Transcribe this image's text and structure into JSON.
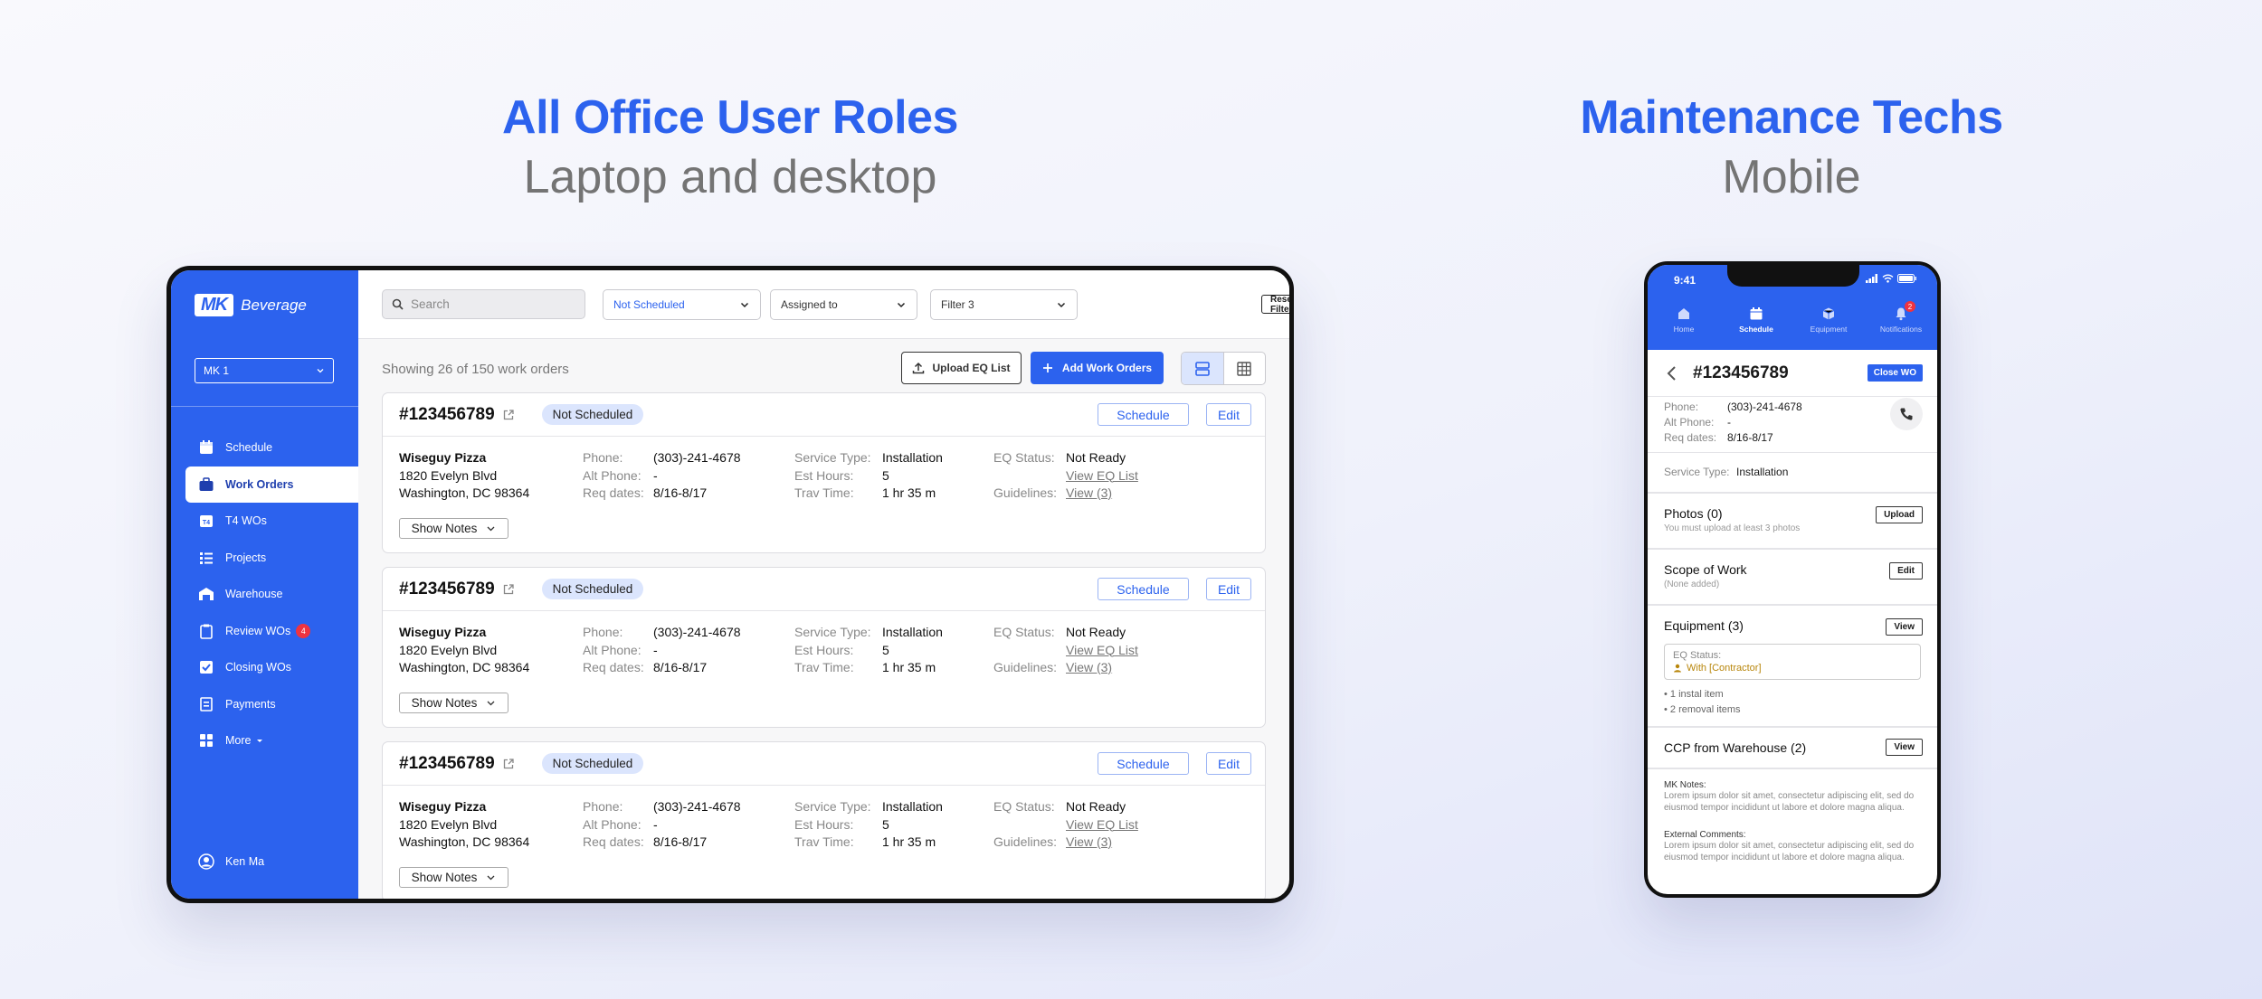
{
  "hero_left": {
    "title": "All Office User Roles",
    "subtitle": "Laptop and desktop"
  },
  "hero_right": {
    "title": "Maintenance Techs",
    "subtitle": "Mobile"
  },
  "sidebar": {
    "logo_mk": "MK",
    "logo_text": "Beverage",
    "location": "MK 1",
    "items": [
      {
        "label": "Schedule",
        "icon": "calendar-icon"
      },
      {
        "label": "Work Orders",
        "icon": "briefcase-icon",
        "active": true
      },
      {
        "label": "T4 WOs",
        "icon": "t4-icon"
      },
      {
        "label": "Projects",
        "icon": "list-icon"
      },
      {
        "label": "Warehouse",
        "icon": "warehouse-icon"
      },
      {
        "label": "Review WOs",
        "icon": "clipboard-icon",
        "badge": "4"
      },
      {
        "label": "Closing WOs",
        "icon": "check-square-icon"
      },
      {
        "label": "Payments",
        "icon": "receipt-icon"
      },
      {
        "label": "More",
        "icon": "grid-icon"
      }
    ],
    "user": "Ken Ma"
  },
  "topbar": {
    "search_placeholder": "Search",
    "filter_status": "Not Scheduled",
    "filter_assigned": "Assigned to",
    "filter_3": "Filter 3",
    "reset_label": "Reset Filters",
    "notifications": "2"
  },
  "content": {
    "showing": "Showing 26 of 150 work orders",
    "upload_label": "Upload EQ List",
    "add_label": "Add Work Orders"
  },
  "labels": {
    "phone": "Phone:",
    "alt_phone": "Alt Phone:",
    "req_dates": "Req dates:",
    "service_type": "Service Type:",
    "est_hours": "Est Hours:",
    "trav_time": "Trav Time:",
    "eq_status": "EQ Status:",
    "guidelines": "Guidelines:",
    "schedule": "Schedule",
    "edit": "Edit",
    "show_notes": "Show Notes"
  },
  "work_orders": [
    {
      "id": "#123456789",
      "status": "Not Scheduled",
      "name": "Wiseguy Pizza",
      "address1": "1820 Evelyn Blvd",
      "address2": "Washington, DC 98364",
      "phone": "(303)-241-4678",
      "alt_phone": "-",
      "req_dates": "8/16-8/17",
      "service_type": "Installation",
      "est_hours": "5",
      "trav_time": "1 hr 35 m",
      "eq_status": "Not Ready",
      "eq_link": "View EQ List",
      "guidelines": "View (3)"
    },
    {
      "id": "#123456789",
      "status": "Not Scheduled",
      "name": "Wiseguy Pizza",
      "address1": "1820 Evelyn Blvd",
      "address2": "Washington, DC 98364",
      "phone": "(303)-241-4678",
      "alt_phone": "-",
      "req_dates": "8/16-8/17",
      "service_type": "Installation",
      "est_hours": "5",
      "trav_time": "1 hr 35 m",
      "eq_status": "Not Ready",
      "eq_link": "View EQ List",
      "guidelines": "View (3)"
    },
    {
      "id": "#123456789",
      "status": "Not Scheduled",
      "name": "Wiseguy Pizza",
      "address1": "1820 Evelyn Blvd",
      "address2": "Washington, DC 98364",
      "phone": "(303)-241-4678",
      "alt_phone": "-",
      "req_dates": "8/16-8/17",
      "service_type": "Installation",
      "est_hours": "5",
      "trav_time": "1 hr 35 m",
      "eq_status": "Not Ready",
      "eq_link": "View EQ List",
      "guidelines": "View (3)"
    }
  ],
  "phone": {
    "time": "9:41",
    "tabs": [
      {
        "label": "Home",
        "icon": "home-icon"
      },
      {
        "label": "Schedule",
        "icon": "calendar-icon",
        "active": true
      },
      {
        "label": "Equipment",
        "icon": "box-icon"
      },
      {
        "label": "Notifications",
        "icon": "bell-icon",
        "badge": "2"
      }
    ],
    "wo_id": "#123456789",
    "close_label": "Close WO",
    "phone_label": "Phone:",
    "phone_value": "(303)-241-4678",
    "alt_label": "Alt Phone:",
    "alt_value": "-",
    "req_label": "Req dates:",
    "req_value": "8/16-8/17",
    "service_label": "Service Type:",
    "service_value": "Installation",
    "photos_title": "Photos (0)",
    "photos_sub": "You must upload at least 3 photos",
    "upload_label": "Upload",
    "scope_title": "Scope of Work",
    "scope_sub": "(None added)",
    "edit_label": "Edit",
    "equipment_title": "Equipment (3)",
    "view_label": "View",
    "eq_status_label": "EQ Status:",
    "eq_status_value": "With [Contractor]",
    "bullets": [
      "1 instal item",
      "2 removal items"
    ],
    "ccp_title": "CCP from Warehouse (2)",
    "mk_notes_label": "MK Notes:",
    "mk_notes": "Lorem ipsum dolor sit amet, consectetur adipiscing elit, sed do eiusmod tempor incididunt ut labore et dolore magna aliqua.",
    "ext_label": "External Comments:",
    "ext_notes": "Lorem ipsum dolor sit amet, consectetur adipiscing elit, sed do eiusmod tempor incididunt ut labore et dolore magna aliqua."
  },
  "colors": {
    "accent": "#2c62ee",
    "badge": "#ef3340",
    "pill": "#dbe5fd",
    "eq_contractor": "#b8860b"
  }
}
